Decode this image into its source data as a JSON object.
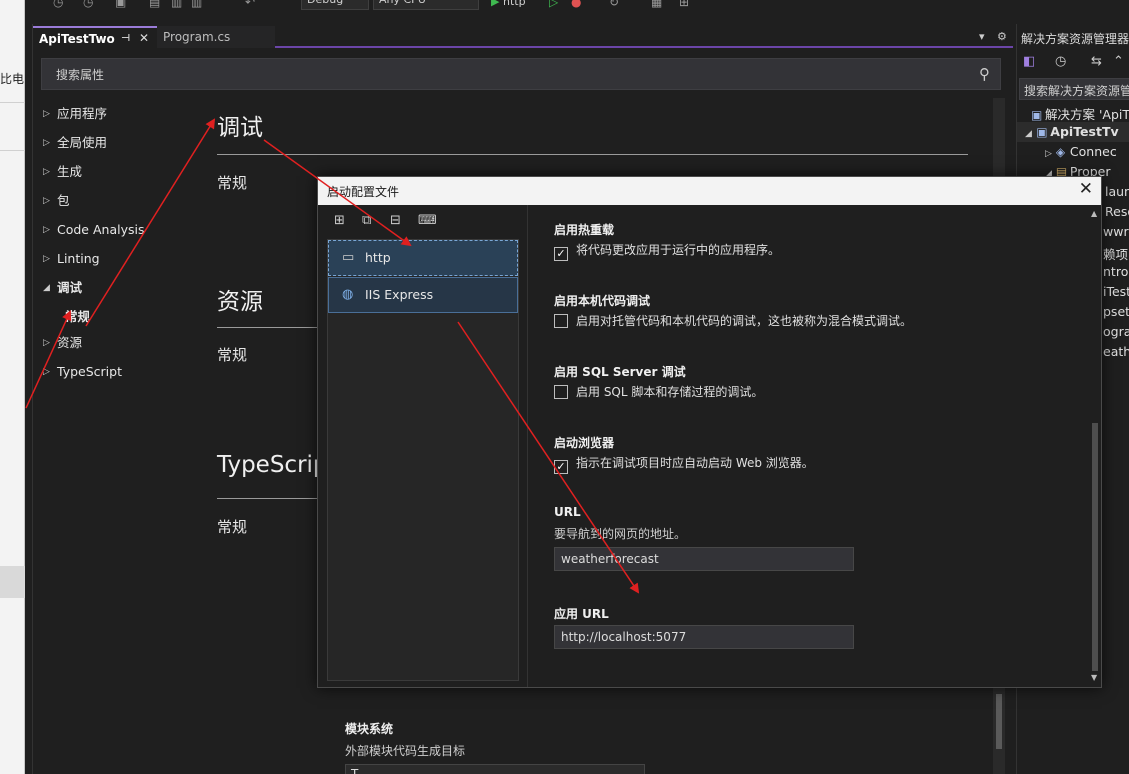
{
  "external": {
    "left_text": "比电"
  },
  "toolbar": {
    "config": "Debug",
    "platform": "Any CPU",
    "run_profile": "http"
  },
  "tabs": [
    {
      "label": "ApiTestTwo",
      "active": true
    },
    {
      "label": "Program.cs",
      "active": false
    }
  ],
  "search": {
    "placeholder": "搜索属性"
  },
  "nav": {
    "items": [
      {
        "label": "应用程序",
        "arrow": "▷"
      },
      {
        "label": "全局使用",
        "arrow": "▷"
      },
      {
        "label": "生成",
        "arrow": "▷"
      },
      {
        "label": "包",
        "arrow": "▷"
      },
      {
        "label": "Code Analysis",
        "arrow": "▷"
      },
      {
        "label": "Linting",
        "arrow": "▷"
      },
      {
        "label": "调试",
        "arrow": "◢"
      },
      {
        "label": "常规",
        "arrow": ""
      },
      {
        "label": "资源",
        "arrow": "▷"
      },
      {
        "label": "TypeScript",
        "arrow": "▷"
      }
    ]
  },
  "sections": [
    {
      "title": "调试",
      "sub": "常规"
    },
    {
      "title": "资源",
      "sub": "常规"
    },
    {
      "title": "TypeScrip",
      "sub": "常规"
    }
  ],
  "bottom_field": {
    "title": "模块系统",
    "desc": "外部模块代码生成目标",
    "value": "T"
  },
  "solution_explorer": {
    "title": "解决方案资源管理器",
    "search_placeholder": "搜索解决方案资源管",
    "rows": [
      {
        "icon": "▣",
        "label": "解决方案 'ApiT"
      },
      {
        "icon": "▣",
        "label": "ApiTestTv"
      },
      {
        "icon": "◈",
        "label": "Connec"
      },
      {
        "icon": "▤",
        "label": "Proper"
      },
      {
        "icon": "",
        "label": "laun"
      },
      {
        "icon": "",
        "label": "Reso"
      },
      {
        "icon": "",
        "label": "wwro"
      },
      {
        "icon": "",
        "label": "赖项"
      },
      {
        "icon": "",
        "label": "ntrol"
      },
      {
        "icon": "",
        "label": "iTest"
      },
      {
        "icon": "",
        "label": "psett"
      },
      {
        "icon": "",
        "label": "ogran"
      },
      {
        "icon": "",
        "label": "eathe"
      }
    ]
  },
  "dialog": {
    "title": "启动配置文件",
    "profiles": [
      {
        "label": "http",
        "selected": true
      },
      {
        "label": "IIS Express",
        "selected": false
      }
    ],
    "options": [
      {
        "title": "启用热重载",
        "checked": true,
        "text": "将代码更改应用于运行中的应用程序。"
      },
      {
        "title": "启用本机代码调试",
        "checked": false,
        "text": "启用对托管代码和本机代码的调试，这也被称为混合模式调试。"
      },
      {
        "title": "启用 SQL Server 调试",
        "checked": false,
        "text": "启用 SQL 脚本和存储过程的调试。"
      },
      {
        "title": "启动浏览器",
        "checked": true,
        "text": "指示在调试项目时应自动启动 Web 浏览器。"
      }
    ],
    "url": {
      "title": "URL",
      "desc": "要导航到的网页的地址。",
      "value": "weatherforecast"
    },
    "app_url": {
      "title": "应用 URL",
      "value": "http://localhost:5077"
    }
  },
  "colors": {
    "accent": "#6b45a8",
    "selection": "#2a4157",
    "annotation_arrow": "#e02020"
  }
}
